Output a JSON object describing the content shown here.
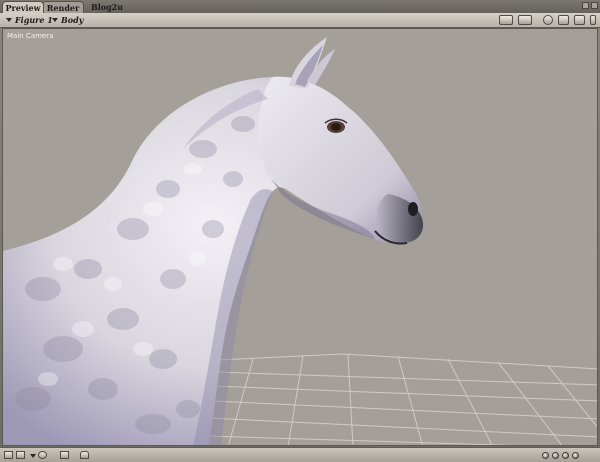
{
  "tabs": [
    {
      "label": "Preview",
      "active": true
    },
    {
      "label": "Render",
      "active": false
    },
    {
      "label": "Blog2u",
      "active": false
    }
  ],
  "header": {
    "figure_selector": "Figure 1",
    "part_selector": "Body",
    "icons": [
      "display-mode-icon",
      "layers-icon",
      "render-style-icon",
      "move-icon",
      "rotate-icon",
      "light-icon"
    ]
  },
  "viewport": {
    "camera_label": "Main Camera",
    "background_color": "#a49f98"
  },
  "footer": {
    "icons": [
      "frame-icon",
      "document-icon",
      "sphere-icon",
      "link-icon",
      "figure-icon",
      "view-dot-1",
      "view-dot-2",
      "view-dot-3",
      "view-dot-4"
    ]
  },
  "colors": {
    "chrome_light": "#d4d0c7",
    "chrome_dark": "#65625b",
    "viewport_bg": "#a49f98",
    "grid_line": "#d4cfc8"
  }
}
